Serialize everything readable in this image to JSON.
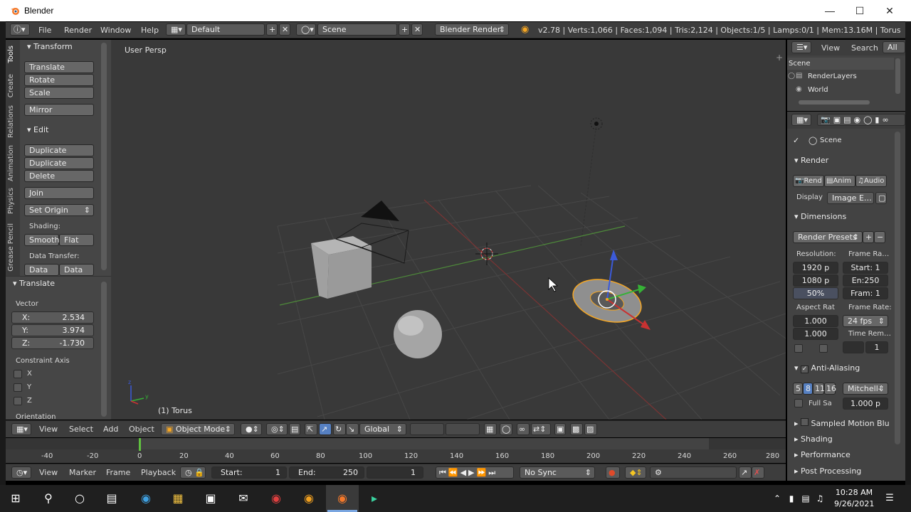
{
  "window": {
    "title": "Blender"
  },
  "infobar": {
    "menus": [
      "File",
      "Render",
      "Window",
      "Help"
    ],
    "screen_layout": "Default",
    "scene": "Scene",
    "render_engine": "Blender Render",
    "stats": "v2.78 | Verts:1,066 | Faces:1,094 | Tris:2,124 | Objects:1/5 | Lamps:0/1 | Mem:13.16M | Torus"
  },
  "toolshelf": {
    "tabs": [
      "Tools",
      "Create",
      "Relations",
      "Animation",
      "Physics",
      "Grease Pencil"
    ],
    "transform_header": "Transform",
    "translate": "Translate",
    "rotate": "Rotate",
    "scale": "Scale",
    "mirror": "Mirror",
    "edit_header": "Edit",
    "duplicate": "Duplicate",
    "duplicate_linked": "Duplicate Linked",
    "delete": "Delete",
    "join": "Join",
    "set_origin": "Set Origin",
    "shading_label": "Shading:",
    "smooth": "Smooth",
    "flat": "Flat",
    "data_transfer_label": "Data Transfer:",
    "data": "Data",
    "data_layers": "Data La",
    "operator_header": "Translate",
    "vector_label": "Vector",
    "x_label": "X:",
    "x_value": "2.534",
    "y_label": "Y:",
    "y_value": "3.974",
    "z_label": "Z:",
    "z_value": "-1.730",
    "constraint_label": "Constraint Axis",
    "axis_x": "X",
    "axis_y": "Y",
    "axis_z": "Z",
    "orientation_label": "Orientation"
  },
  "viewport": {
    "view_name": "User Persp",
    "object_label": "(1) Torus"
  },
  "header3d": {
    "view": "View",
    "select": "Select",
    "add": "Add",
    "object": "Object",
    "mode": "Object Mode",
    "orientation": "Global"
  },
  "timeline": {
    "ticks": [
      "-40",
      "-20",
      "0",
      "20",
      "40",
      "60",
      "80",
      "100",
      "120",
      "140",
      "160",
      "180",
      "200",
      "220",
      "240",
      "260",
      "280"
    ]
  },
  "timeline_header": {
    "view": "View",
    "marker": "Marker",
    "frame": "Frame",
    "playback": "Playback",
    "start_label": "Start:",
    "start": "1",
    "end_label": "End:",
    "end": "250",
    "current": "1",
    "sync": "No Sync"
  },
  "outliner": {
    "view": "View",
    "search": "Search",
    "filter": "All Sc",
    "items": [
      "Scene",
      "RenderLayers",
      "World"
    ]
  },
  "properties": {
    "context": "Scene",
    "render_header": "Render",
    "rend": "Rend",
    "anim": "Anim",
    "audio": "Audio",
    "display_label": "Display",
    "display_value": "Image E…",
    "dimensions_header": "Dimensions",
    "render_presets": "Render Presets",
    "resolution_label": "Resolution:",
    "frame_range_label": "Frame Ra…",
    "res_x": "1920 p",
    "res_y": "1080 p",
    "res_pct": "50%",
    "start": "Start: 1",
    "end": "En:250",
    "frame_step": "Fram: 1",
    "aspect_label": "Aspect Rat",
    "frame_rate_label": "Frame Rate:",
    "aspect_x": "1.000",
    "aspect_y": "1.000",
    "fps": "24 fps",
    "time_remap": "Time Rem…",
    "time_val": "1",
    "aa_header": "Anti-Aliasing",
    "aa_samples": [
      "5",
      "8",
      "11",
      "16"
    ],
    "aa_filter": "Mitchell-",
    "full_sample": "Full Sa",
    "filter_size": "1.000 p",
    "sampled_motion_blur": "Sampled Motion Blur",
    "shading": "Shading",
    "performance": "Performance",
    "post_processing": "Post Processing"
  },
  "taskbar": {
    "time": "10:28 AM",
    "date": "9/26/2021"
  },
  "colors": {
    "accent_orange": "#f5a623",
    "selected_blue": "#5680c2",
    "x_axis": "#a83232",
    "y_axis": "#3fa83f"
  }
}
